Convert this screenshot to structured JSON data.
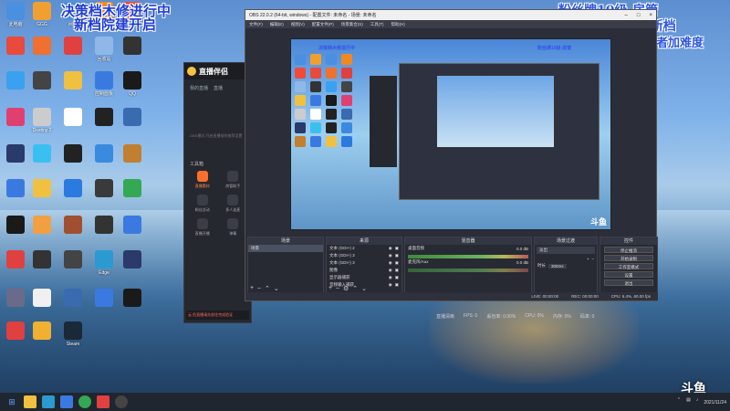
{
  "overlay": {
    "top_left_line1": "决策档木修进行中",
    "top_left_line2": "新档院建开启",
    "top_right_line1": "粉丝牌10级-房管",
    "top_right_line2": "飞机=立即开新档",
    "top_right_line3": "或者加难度"
  },
  "desktop_icons": [
    {
      "label": "此电脑",
      "color": "#4a8fe0"
    },
    {
      "label": "GGG",
      "color": "#f0a030"
    },
    {
      "label": "网络",
      "color": "#4a8fe0"
    },
    {
      "label": "GoodName",
      "color": "#f08a20"
    },
    {
      "label": "",
      "color": "#f04a3a"
    },
    {
      "label": "",
      "color": "#e84a3c"
    },
    {
      "label": "",
      "color": "#f07030"
    },
    {
      "label": "",
      "color": "#e04040"
    },
    {
      "label": "回收站",
      "color": "#8fb8e8"
    },
    {
      "label": "",
      "color": "#333333"
    },
    {
      "label": "",
      "color": "#3aa0f0"
    },
    {
      "label": "",
      "color": "#444444"
    },
    {
      "label": "",
      "color": "#f0c040"
    },
    {
      "label": "控制面板",
      "color": "#3a7ae0"
    },
    {
      "label": "QQ",
      "color": "#1a1a1a"
    },
    {
      "label": "",
      "color": "#e04070"
    },
    {
      "label": "Destiny 2",
      "color": "#cccccc"
    },
    {
      "label": "",
      "color": "#ffffff"
    },
    {
      "label": "",
      "color": "#222222"
    },
    {
      "label": "",
      "color": "#3a6ab0"
    },
    {
      "label": "",
      "color": "#2a3a6a"
    },
    {
      "label": "",
      "color": "#3ac0f0"
    },
    {
      "label": "",
      "color": "#222222"
    },
    {
      "label": "",
      "color": "#3a8ae0"
    },
    {
      "label": "",
      "color": "#c08030"
    },
    {
      "label": "",
      "color": "#3a7ae0"
    },
    {
      "label": "",
      "color": "#f0c040"
    },
    {
      "label": "",
      "color": "#2a7ae0"
    },
    {
      "label": "",
      "color": "#3a3a3a"
    },
    {
      "label": "",
      "color": "#34a853"
    },
    {
      "label": "",
      "color": "#1a1a1a"
    },
    {
      "label": "",
      "color": "#f0a040"
    },
    {
      "label": "",
      "color": "#a05030"
    },
    {
      "label": "",
      "color": "#333333"
    },
    {
      "label": "",
      "color": "#3a7ae0"
    },
    {
      "label": "",
      "color": "#e04040"
    },
    {
      "label": "",
      "color": "#333333"
    },
    {
      "label": "",
      "color": "#444444"
    },
    {
      "label": "Edge",
      "color": "#2a9ad0"
    },
    {
      "label": "",
      "color": "#2a3a6a"
    },
    {
      "label": "",
      "color": "#6a6a8a"
    },
    {
      "label": "",
      "color": "#f0f0f0"
    },
    {
      "label": "",
      "color": "#3a6ab0"
    },
    {
      "label": "",
      "color": "#3a7ae0"
    },
    {
      "label": "",
      "color": "#1a1a1a"
    },
    {
      "label": "",
      "color": "#e04040"
    },
    {
      "label": "",
      "color": "#f0b030"
    },
    {
      "label": "Steam",
      "color": "#1b2838"
    }
  ],
  "helper": {
    "title": "直播伴侣",
    "tab_1": "我的直播",
    "tab_2": "直播",
    "hint": "OBS模式 开启直播前的推荐设置",
    "tools_title": "工具箱",
    "tools": [
      "直播素材",
      "房管助手",
      "粉丝总动",
      "多人连麦",
      "直播开播",
      "弹幕"
    ],
    "notice": "云 危直播请先前往完成验证"
  },
  "obs": {
    "title": "OBS 22.0.2 (64-bit, windows) - 配置文件: 未命名 - 场景: 未命名",
    "menu": [
      "文件(F)",
      "编辑(E)",
      "视图(V)",
      "配置文件(P)",
      "场景集合(S)",
      "工具(T)",
      "帮助(H)"
    ],
    "scenes_title": "场景",
    "scenes": [
      "场景"
    ],
    "sources_title": "来源",
    "sources": [
      "文本 (GDI+) 2",
      "文本 (GDI+) 3",
      "文本 (GDI+) 3",
      "图像",
      "显示器捕获",
      "音频输入捕获"
    ],
    "mixer_title": "混音器",
    "mixer": [
      {
        "name": "桌面音频",
        "level": "0.0 dB"
      },
      {
        "name": "麦克风/Aux",
        "level": "0.0 dB"
      }
    ],
    "transitions_title": "场景过渡",
    "transition": "淡出",
    "duration_label": "时长",
    "duration": "300ms",
    "controls_title": "控件",
    "controls": [
      "停止推流",
      "开始录制",
      "工作室模式",
      "设置",
      "退出"
    ],
    "status": {
      "live": "LIVE: 00:00:00",
      "rec": "REC: 00:00:00",
      "cpu": "CPU: 6.4%, 60.00 fps"
    }
  },
  "under_status": [
    "直播清晰",
    "FPS: 0",
    "丢包率: 0.00%",
    "CPU: 0%",
    "内存: 0%",
    "码率: 0"
  ],
  "watermark": "斗鱼",
  "taskbar": {
    "time": "",
    "date": "2021/11/24"
  }
}
